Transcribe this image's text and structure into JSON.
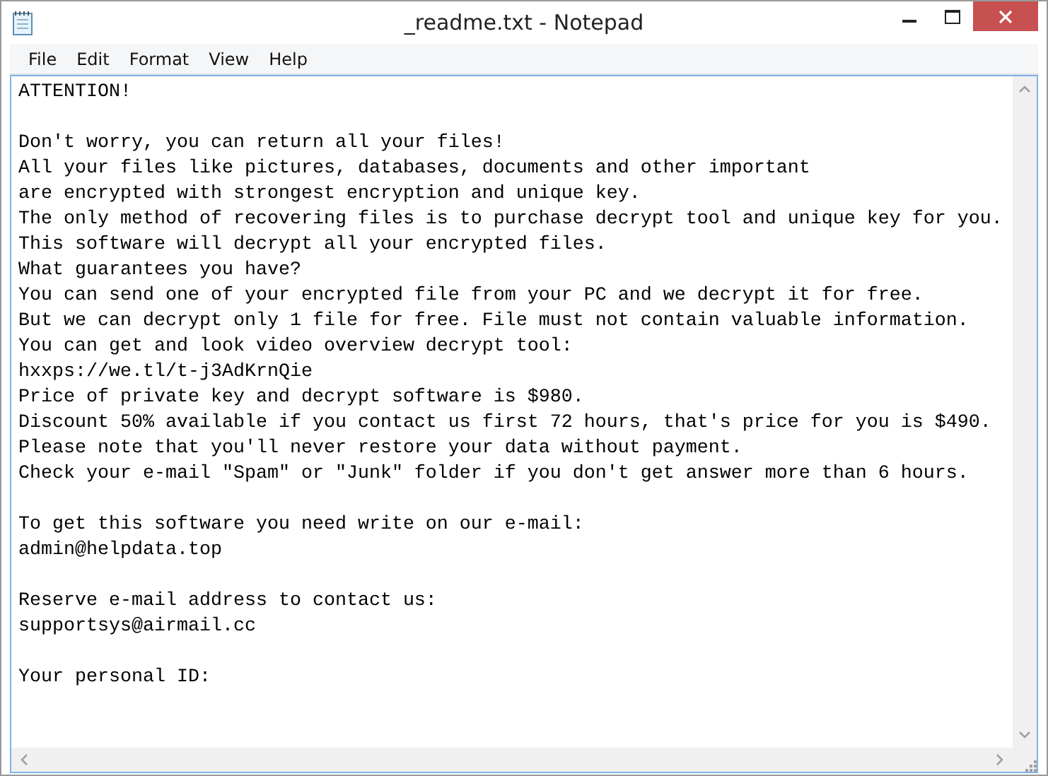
{
  "window": {
    "title": "_readme.txt - Notepad"
  },
  "menu": [
    "File",
    "Edit",
    "Format",
    "View",
    "Help"
  ],
  "document": {
    "paragraphs": [
      [
        "ATTENTION!"
      ],
      [
        "Don't worry, you can return all your files!",
        "All your files like pictures, databases, documents and other important",
        "are encrypted with strongest encryption and unique key.",
        "The only method of recovering files is to purchase decrypt tool and unique key for you.",
        "This software will decrypt all your encrypted files.",
        "What guarantees you have?",
        "You can send one of your encrypted file from your PC and we decrypt it for free.",
        "But we can decrypt only 1 file for free. File must not contain valuable information.",
        "You can get and look video overview decrypt tool:",
        "hxxps://we.tl/t-j3AdKrnQie",
        "Price of private key and decrypt software is $980.",
        "Discount 50% available if you contact us first 72 hours, that's price for you is $490.",
        "Please note that you'll never restore your data without payment.",
        "Check your e-mail \"Spam\" or \"Junk\" folder if you don't get answer more than 6 hours."
      ],
      [
        "To get this software you need write on our e-mail:",
        "admin@helpdata.top"
      ],
      [
        "Reserve e-mail address to contact us:",
        "supportsys@airmail.cc"
      ],
      [
        "Your personal ID:"
      ]
    ]
  }
}
